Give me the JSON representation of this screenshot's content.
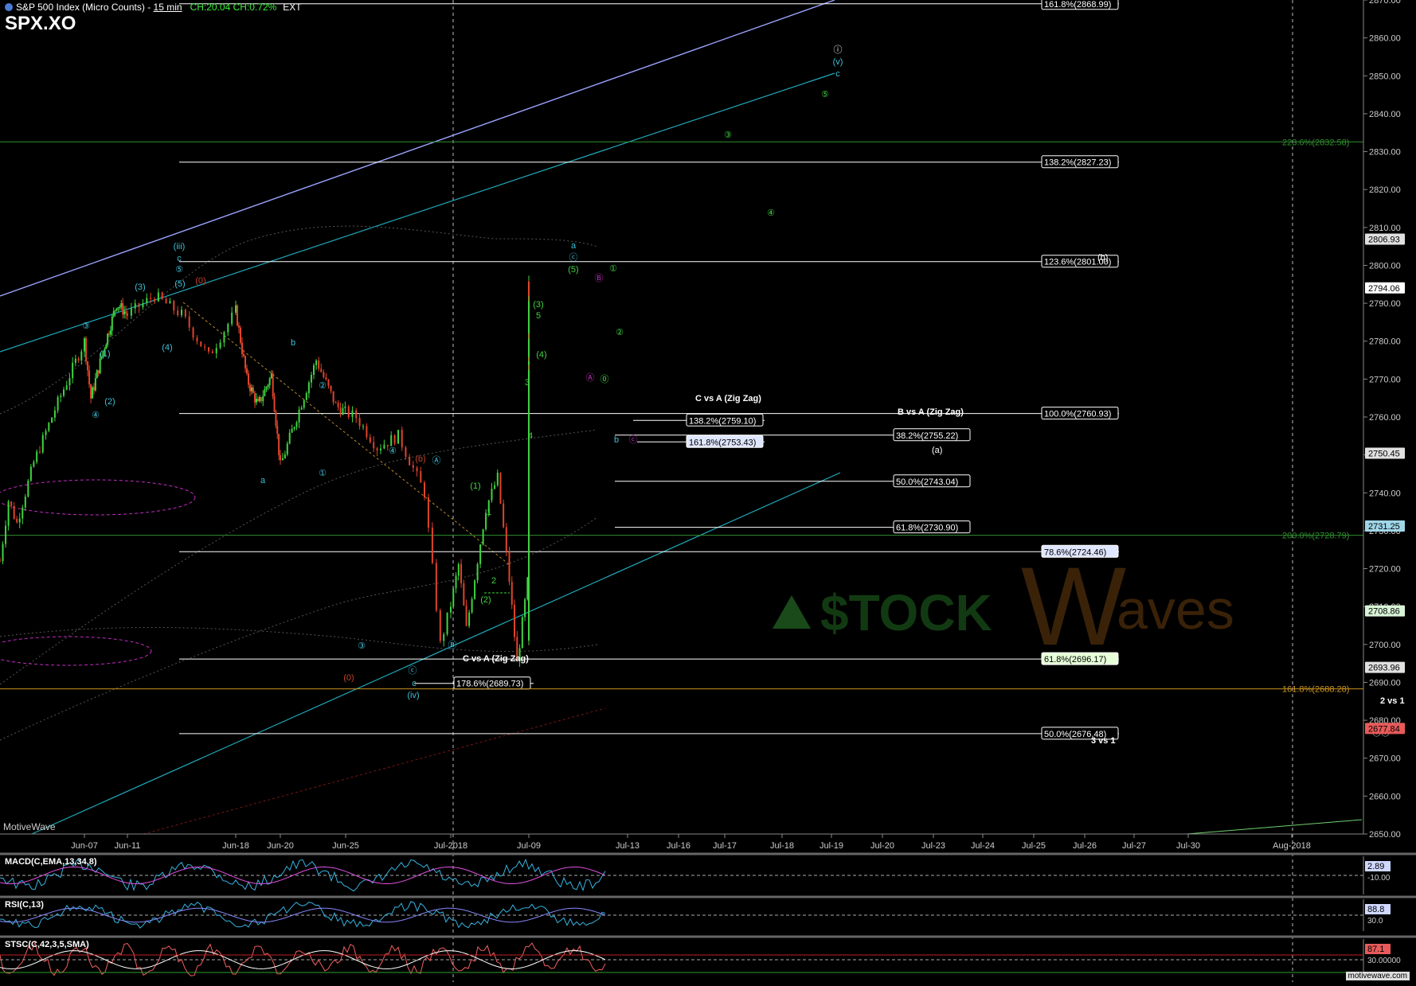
{
  "header": {
    "title": "S&P 500 Index (Micro Counts)",
    "timeframe": "15 min",
    "change": "CH:20.04  CH:0.72%",
    "session": "EXT",
    "symbol": "SPX.XO"
  },
  "brand": "MotiveWave",
  "footer_site": "motivewave.com",
  "watermark": {
    "letters_left": "$TOCK",
    "big_w": "W",
    "letters_right": "aves"
  },
  "chart_data": {
    "type": "candlestick",
    "y_axis": {
      "min": 2650,
      "max": 2870,
      "ticks": [
        2650,
        2660,
        2670,
        2680,
        2690,
        2700,
        2710,
        2720,
        2730,
        2740,
        2750,
        2760,
        2770,
        2780,
        2790,
        2800,
        2810,
        2820,
        2830,
        2840,
        2850,
        2860,
        2870
      ],
      "format": "0.00"
    },
    "x_ticks": [
      "Jun-07",
      "Jun-11",
      "Jun-18",
      "Jun-20",
      "Jun-25",
      "Jul-2018",
      "Jul-09",
      "Jul-13",
      "Jul-16",
      "Jul-17",
      "Jul-18",
      "Jul-19",
      "Jul-20",
      "Jul-23",
      "Jul-24",
      "Jul-25",
      "Jul-26",
      "Jul-27",
      "Jul-30",
      "Aug-2018"
    ],
    "price_path": [
      [
        0,
        2722
      ],
      [
        0.1,
        2738
      ],
      [
        0.2,
        2732
      ],
      [
        0.4,
        2748
      ],
      [
        0.65,
        2762
      ],
      [
        1.0,
        2780
      ],
      [
        1.15,
        2765
      ],
      [
        1.4,
        2776
      ],
      [
        1.75,
        2790
      ],
      [
        2.0,
        2787
      ],
      [
        2.25,
        2792
      ],
      [
        2.5,
        2787
      ],
      [
        2.75,
        2776
      ],
      [
        3.0,
        2788
      ],
      [
        3.25,
        2770
      ],
      [
        3.5,
        2763
      ],
      [
        3.8,
        2771
      ],
      [
        4.0,
        2747
      ],
      [
        4.25,
        2760
      ],
      [
        4.55,
        2775
      ],
      [
        4.85,
        2763
      ],
      [
        5.1,
        2760
      ],
      [
        5.3,
        2752
      ],
      [
        5.5,
        2755
      ],
      [
        5.75,
        2740
      ],
      [
        5.9,
        2700
      ],
      [
        6.1,
        2721
      ],
      [
        6.2,
        2704
      ],
      [
        6.45,
        2736
      ],
      [
        6.6,
        2744
      ],
      [
        6.75,
        2717
      ],
      [
        6.85,
        2695
      ],
      [
        7.05,
        2727
      ],
      [
        7.2,
        2722
      ],
      [
        7.35,
        2745
      ],
      [
        7.55,
        2729
      ],
      [
        7.65,
        2701
      ],
      [
        7.8,
        2712
      ],
      [
        8.0,
        2730
      ],
      [
        8.2,
        2738
      ],
      [
        8.35,
        2722
      ],
      [
        8.5,
        2732
      ],
      [
        8.65,
        2742
      ],
      [
        8.8,
        2762
      ],
      [
        9.0,
        2765
      ],
      [
        9.1,
        2760
      ],
      [
        9.3,
        2778
      ],
      [
        9.5,
        2785
      ],
      [
        9.7,
        2788
      ],
      [
        9.85,
        2794
      ],
      [
        10.0,
        2792
      ],
      [
        10.15,
        2796
      ],
      [
        10.3,
        2790
      ],
      [
        10.5,
        2774
      ],
      [
        10.7,
        2778
      ],
      [
        10.9,
        2786
      ],
      [
        11.0,
        2794
      ]
    ],
    "fib_levels": [
      {
        "label": "161.8%(2868.99)",
        "value": 2868.99,
        "color": "#ffffff"
      },
      {
        "label": "138.2%(2827.23)",
        "value": 2827.23,
        "color": "#ffffff"
      },
      {
        "label": "123.6%(2801.00)",
        "value": 2801.0,
        "color": "#ffffff"
      },
      {
        "label": "100.0%(2760.93)",
        "value": 2760.93,
        "color": "#ffffff"
      },
      {
        "label": "138.2%(2759.10)",
        "value": 2759.1,
        "color": "#ffffff"
      },
      {
        "label": "38.2%(2755.22)",
        "value": 2755.22,
        "color": "#ffffff"
      },
      {
        "label": "161.8%(2753.43)",
        "value": 2753.43,
        "color": "#ffffff"
      },
      {
        "label": "50.0%(2743.04)",
        "value": 2743.04,
        "color": "#ffffff"
      },
      {
        "label": "61.8%(2730.90)",
        "value": 2730.9,
        "color": "#ffffff"
      },
      {
        "label": "78.6%(2724.46)",
        "value": 2724.46,
        "color": "#ffffff"
      },
      {
        "label": "61.8%(2696.17)",
        "value": 2696.17,
        "color": "#ffffff"
      },
      {
        "label": "178.6%(2689.73)",
        "value": 2689.73,
        "color": "#ffffff"
      },
      {
        "label": "50.0%(2676.48)",
        "value": 2676.48,
        "color": "#ffffff"
      },
      {
        "label": "223.6%(2832.58)",
        "value": 2832.58,
        "color": "#2f8f2f"
      },
      {
        "label": "200.0%(2728.79)",
        "value": 2728.79,
        "color": "#2f8f2f"
      },
      {
        "label": "161.8%(2688.28)",
        "value": 2688.28,
        "color": "#c89420"
      }
    ],
    "price_tags": [
      {
        "label": "2806.93",
        "value": 2806.93,
        "color": "#e0e0e0"
      },
      {
        "label": "2794.06",
        "value": 2794.06,
        "color": "#ffffff"
      },
      {
        "label": "2750.45",
        "value": 2750.45,
        "color": "#e0e0e0"
      },
      {
        "label": "2731.25",
        "value": 2731.25,
        "color": "#9fd6e8"
      },
      {
        "label": "2708.86",
        "value": 2708.86,
        "color": "#d8f4d8"
      },
      {
        "label": "2693.96",
        "value": 2693.96,
        "color": "#e0e0e0"
      },
      {
        "label": "2677.84",
        "value": 2677.84,
        "color": "#e85a5a"
      }
    ],
    "annotations": {
      "c_vs_a_top": "C vs A (Zig Zag)",
      "b_vs_a": "B vs A (Zig Zag)",
      "c_vs_a_bottom": "C vs A (Zig Zag)",
      "two_vs_one": "2 vs 1",
      "three_vs_one": "3 vs 1",
      "paren_a": "(a)",
      "paren_b": "(b)"
    },
    "indicators": [
      {
        "name": "MACD(C,EMA,13,34,8)",
        "value": "2.89",
        "ref": "-10.00"
      },
      {
        "name": "RSI(C,13)",
        "value": "88.8",
        "ref": "30.0"
      },
      {
        "name": "STSC(C,42,3,5,SMA)",
        "value": "87.1",
        "ref": "30.00000"
      }
    ]
  }
}
